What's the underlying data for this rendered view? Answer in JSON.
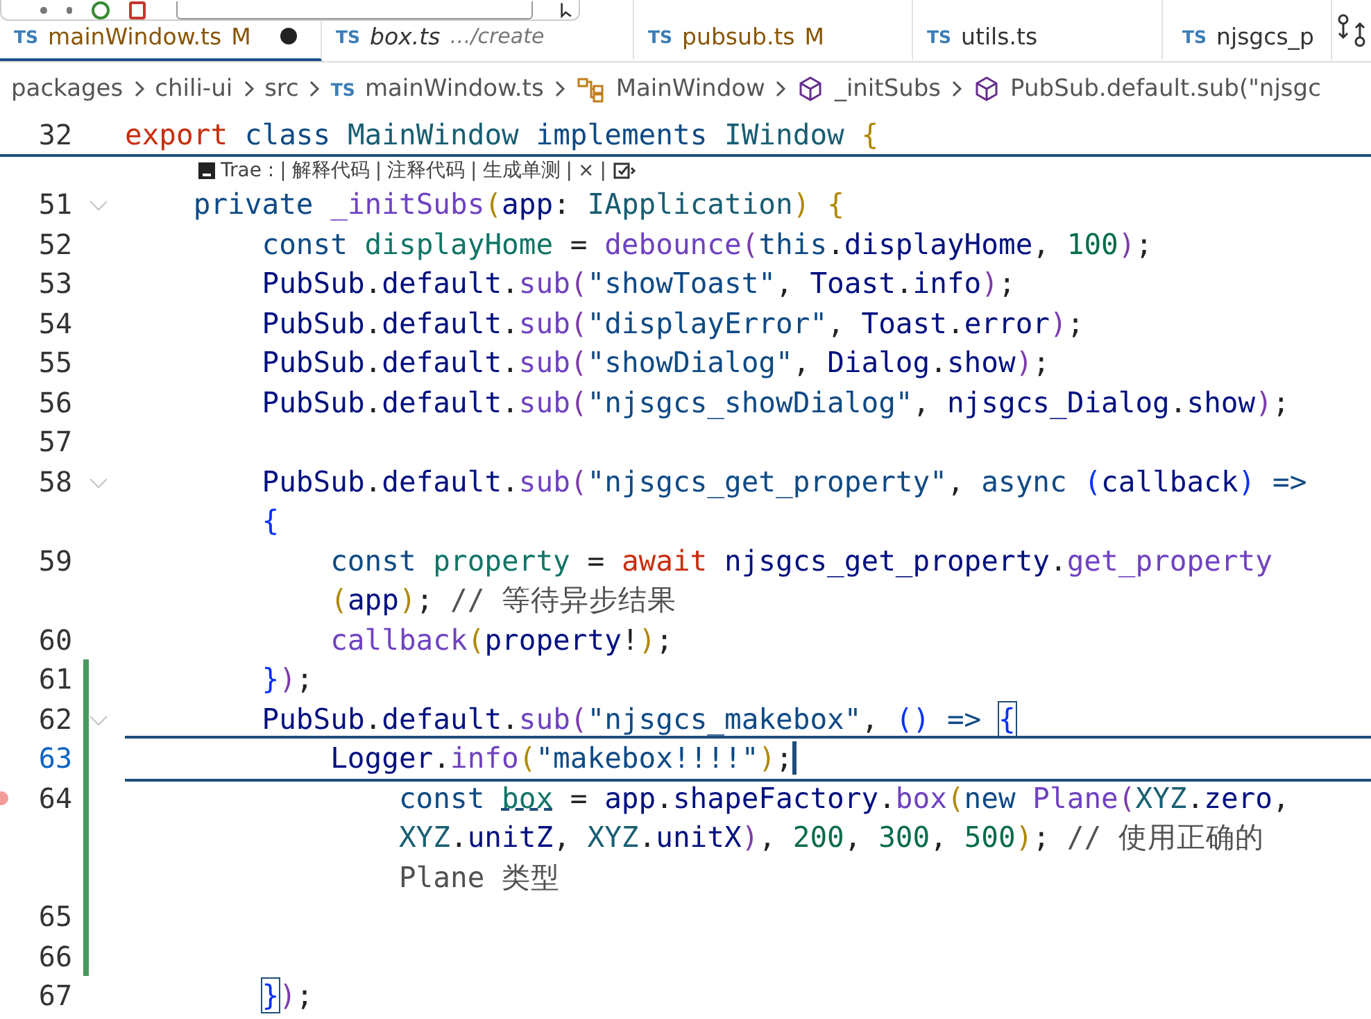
{
  "tabs": [
    {
      "label": "mainWindow.ts",
      "badge": "TS",
      "status": "M",
      "modified": true,
      "dirty": true,
      "preview": false,
      "selected": true
    },
    {
      "label": "box.ts",
      "badge": "TS",
      "description": "…/create",
      "modified": false,
      "dirty": false,
      "preview": true,
      "selected": false
    },
    {
      "label": "pubsub.ts",
      "badge": "TS",
      "status": "M",
      "modified": true,
      "dirty": false,
      "preview": false,
      "selected": false
    },
    {
      "label": "utils.ts",
      "badge": "TS",
      "modified": false,
      "dirty": false,
      "preview": false,
      "selected": false
    },
    {
      "label": "njsgcs_p",
      "badge": "TS",
      "modified": false,
      "dirty": false,
      "preview": false,
      "selected": false
    }
  ],
  "breadcrumb": [
    {
      "kind": "folder",
      "label": "packages"
    },
    {
      "kind": "folder",
      "label": "chili-ui"
    },
    {
      "kind": "folder",
      "label": "src"
    },
    {
      "kind": "file",
      "badge": "TS",
      "label": "mainWindow.ts"
    },
    {
      "kind": "class",
      "label": "MainWindow"
    },
    {
      "kind": "method",
      "label": "_initSubs"
    },
    {
      "kind": "method",
      "label": "PubSub.default.sub(\"njsgc"
    }
  ],
  "sticky_line": {
    "number": "32",
    "tokens": [
      {
        "t": "export ",
        "kind": "kw2"
      },
      {
        "t": "class ",
        "kind": "kw"
      },
      {
        "t": "MainWindow ",
        "kind": "type"
      },
      {
        "t": "implements ",
        "kind": "kw"
      },
      {
        "t": "IWindow ",
        "kind": "type"
      },
      {
        "t": "{",
        "kind": "b1"
      }
    ]
  },
  "codelens": {
    "label": "Trae :",
    "separator": "|",
    "actions": [
      "解释代码",
      "注释代码",
      "生成单测"
    ],
    "close": "×"
  },
  "lines": [
    {
      "number": "51",
      "fold": true,
      "modified": false,
      "current": false,
      "breakpoint": false,
      "rows": [
        {
          "tokens": [
            {
              "t": "private ",
              "kind": "kw"
            },
            {
              "t": "_initSubs",
              "kind": "fn"
            },
            {
              "t": "(",
              "kind": "b1"
            },
            {
              "t": "app",
              "kind": "var"
            },
            {
              "t": ": ",
              "kind": "punc"
            },
            {
              "t": "IApplication",
              "kind": "type"
            },
            {
              "t": ") ",
              "kind": "b1"
            },
            {
              "t": "{",
              "kind": "b1"
            }
          ]
        }
      ],
      "children": [
        {
          "number": "52",
          "fold": false,
          "modified": false,
          "current": false,
          "breakpoint": false,
          "rows": [
            {
              "tokens": [
                {
                  "t": "const ",
                  "kind": "kw"
                },
                {
                  "t": "displayHome",
                  "kind": "decl"
                },
                {
                  "t": " = ",
                  "kind": "punc"
                },
                {
                  "t": "debounce",
                  "kind": "fn"
                },
                {
                  "t": "(",
                  "kind": "b2"
                },
                {
                  "t": "this",
                  "kind": "kw"
                },
                {
                  "t": ".",
                  "kind": "punc"
                },
                {
                  "t": "displayHome",
                  "kind": "var"
                },
                {
                  "t": ", ",
                  "kind": "punc"
                },
                {
                  "t": "100",
                  "kind": "num"
                },
                {
                  "t": ")",
                  "kind": "b2"
                },
                {
                  "t": ";",
                  "kind": "punc"
                }
              ]
            }
          ]
        },
        {
          "number": "53",
          "fold": false,
          "modified": false,
          "current": false,
          "breakpoint": false,
          "rows": [
            {
              "tokens": [
                {
                  "t": "PubSub",
                  "kind": "var"
                },
                {
                  "t": ".",
                  "kind": "punc"
                },
                {
                  "t": "default",
                  "kind": "var"
                },
                {
                  "t": ".",
                  "kind": "punc"
                },
                {
                  "t": "sub",
                  "kind": "fn"
                },
                {
                  "t": "(",
                  "kind": "b2"
                },
                {
                  "t": "\"showToast\"",
                  "kind": "str"
                },
                {
                  "t": ", ",
                  "kind": "punc"
                },
                {
                  "t": "Toast",
                  "kind": "var"
                },
                {
                  "t": ".",
                  "kind": "punc"
                },
                {
                  "t": "info",
                  "kind": "var"
                },
                {
                  "t": ")",
                  "kind": "b2"
                },
                {
                  "t": ";",
                  "kind": "punc"
                }
              ]
            }
          ]
        },
        {
          "number": "54",
          "fold": false,
          "modified": false,
          "current": false,
          "breakpoint": false,
          "rows": [
            {
              "tokens": [
                {
                  "t": "PubSub",
                  "kind": "var"
                },
                {
                  "t": ".",
                  "kind": "punc"
                },
                {
                  "t": "default",
                  "kind": "var"
                },
                {
                  "t": ".",
                  "kind": "punc"
                },
                {
                  "t": "sub",
                  "kind": "fn"
                },
                {
                  "t": "(",
                  "kind": "b2"
                },
                {
                  "t": "\"displayError\"",
                  "kind": "str"
                },
                {
                  "t": ", ",
                  "kind": "punc"
                },
                {
                  "t": "Toast",
                  "kind": "var"
                },
                {
                  "t": ".",
                  "kind": "punc"
                },
                {
                  "t": "error",
                  "kind": "var"
                },
                {
                  "t": ")",
                  "kind": "b2"
                },
                {
                  "t": ";",
                  "kind": "punc"
                }
              ]
            }
          ]
        },
        {
          "number": "55",
          "fold": false,
          "modified": false,
          "current": false,
          "breakpoint": false,
          "rows": [
            {
              "tokens": [
                {
                  "t": "PubSub",
                  "kind": "var"
                },
                {
                  "t": ".",
                  "kind": "punc"
                },
                {
                  "t": "default",
                  "kind": "var"
                },
                {
                  "t": ".",
                  "kind": "punc"
                },
                {
                  "t": "sub",
                  "kind": "fn"
                },
                {
                  "t": "(",
                  "kind": "b2"
                },
                {
                  "t": "\"showDialog\"",
                  "kind": "str"
                },
                {
                  "t": ", ",
                  "kind": "punc"
                },
                {
                  "t": "Dialog",
                  "kind": "var"
                },
                {
                  "t": ".",
                  "kind": "punc"
                },
                {
                  "t": "show",
                  "kind": "var"
                },
                {
                  "t": ")",
                  "kind": "b2"
                },
                {
                  "t": ";",
                  "kind": "punc"
                }
              ]
            }
          ]
        },
        {
          "number": "56",
          "fold": false,
          "modified": false,
          "current": false,
          "breakpoint": false,
          "rows": [
            {
              "tokens": [
                {
                  "t": "PubSub",
                  "kind": "var"
                },
                {
                  "t": ".",
                  "kind": "punc"
                },
                {
                  "t": "default",
                  "kind": "var"
                },
                {
                  "t": ".",
                  "kind": "punc"
                },
                {
                  "t": "sub",
                  "kind": "fn"
                },
                {
                  "t": "(",
                  "kind": "b2"
                },
                {
                  "t": "\"njsgcs_showDialog\"",
                  "kind": "str"
                },
                {
                  "t": ", ",
                  "kind": "punc"
                },
                {
                  "t": "njsgcs_Dialog",
                  "kind": "var"
                },
                {
                  "t": ".",
                  "kind": "punc"
                },
                {
                  "t": "show",
                  "kind": "var"
                },
                {
                  "t": ")",
                  "kind": "b2"
                },
                {
                  "t": ";",
                  "kind": "punc"
                }
              ]
            }
          ]
        },
        {
          "number": "57",
          "fold": false,
          "modified": false,
          "current": false,
          "breakpoint": false
        },
        {
          "number": "58",
          "fold": true,
          "modified": false,
          "current": false,
          "breakpoint": false,
          "rows": [
            {
              "tokens": [
                {
                  "t": "PubSub",
                  "kind": "var"
                },
                {
                  "t": ".",
                  "kind": "punc"
                },
                {
                  "t": "default",
                  "kind": "var"
                },
                {
                  "t": ".",
                  "kind": "punc"
                },
                {
                  "t": "sub",
                  "kind": "fn"
                },
                {
                  "t": "(",
                  "kind": "b2"
                },
                {
                  "t": "\"njsgcs_get_property\"",
                  "kind": "str"
                },
                {
                  "t": ", ",
                  "kind": "punc"
                },
                {
                  "t": "async ",
                  "kind": "kw"
                },
                {
                  "t": "(",
                  "kind": "b3"
                },
                {
                  "t": "callback",
                  "kind": "var"
                },
                {
                  "t": ")",
                  "kind": "b3"
                },
                {
                  "t": " =>",
                  "kind": "kw"
                }
              ]
            },
            {
              "tokens": [
                {
                  "t": "{",
                  "kind": "b3"
                }
              ]
            }
          ],
          "children": [
            {
              "number": "59",
              "fold": false,
              "modified": false,
              "current": false,
              "breakpoint": false,
              "rows": [
                {
                  "tokens": [
                    {
                      "t": "const ",
                      "kind": "kw"
                    },
                    {
                      "t": "property",
                      "kind": "decl"
                    },
                    {
                      "t": " = ",
                      "kind": "punc"
                    },
                    {
                      "t": "await ",
                      "kind": "kw2"
                    },
                    {
                      "t": "njsgcs_get_property",
                      "kind": "var"
                    },
                    {
                      "t": ".",
                      "kind": "punc"
                    },
                    {
                      "t": "get_property",
                      "kind": "fn"
                    }
                  ]
                },
                {
                  "tokens": [
                    {
                      "t": "(",
                      "kind": "b1"
                    },
                    {
                      "t": "app",
                      "kind": "var"
                    },
                    {
                      "t": ")",
                      "kind": "b1"
                    },
                    {
                      "t": "; ",
                      "kind": "punc"
                    },
                    {
                      "t": "// 等待异步结果",
                      "kind": "com"
                    }
                  ]
                }
              ]
            },
            {
              "number": "60",
              "fold": false,
              "modified": false,
              "current": false,
              "breakpoint": false,
              "rows": [
                {
                  "tokens": [
                    {
                      "t": "callback",
                      "kind": "fn"
                    },
                    {
                      "t": "(",
                      "kind": "b1"
                    },
                    {
                      "t": "property",
                      "kind": "var"
                    },
                    {
                      "t": "!",
                      "kind": "punc"
                    },
                    {
                      "t": ")",
                      "kind": "b1"
                    },
                    {
                      "t": ";",
                      "kind": "punc"
                    }
                  ]
                }
              ]
            }
          ]
        },
        {
          "number": "61",
          "fold": false,
          "modified": true,
          "current": false,
          "breakpoint": false,
          "rows": [
            {
              "tokens": [
                {
                  "t": "}",
                  "kind": "b3"
                },
                {
                  "t": ")",
                  "kind": "b2"
                },
                {
                  "t": ";",
                  "kind": "punc"
                }
              ]
            }
          ]
        },
        {
          "number": "62",
          "fold": true,
          "modified": true,
          "current": false,
          "breakpoint": false,
          "rows": [
            {
              "tokens": [
                {
                  "t": "PubSub",
                  "kind": "var"
                },
                {
                  "t": ".",
                  "kind": "punc"
                },
                {
                  "t": "default",
                  "kind": "var"
                },
                {
                  "t": ".",
                  "kind": "punc"
                },
                {
                  "t": "sub",
                  "kind": "fn"
                },
                {
                  "t": "(",
                  "kind": "b2"
                },
                {
                  "t": "\"njsgcs_makebox\"",
                  "kind": "str"
                },
                {
                  "t": ", ",
                  "kind": "punc"
                },
                {
                  "t": "() ",
                  "kind": "b3"
                },
                {
                  "t": "=> ",
                  "kind": "kw"
                },
                {
                  "t": "{",
                  "kind": "b3m"
                }
              ]
            }
          ],
          "children": [
            {
              "number": "63",
              "fold": false,
              "modified": true,
              "current": true,
              "breakpoint": false,
              "rows": [
                {
                  "tokens": [
                    {
                      "t": "Logger",
                      "kind": "var"
                    },
                    {
                      "t": ".",
                      "kind": "punc"
                    },
                    {
                      "t": "info",
                      "kind": "fn"
                    },
                    {
                      "t": "(",
                      "kind": "b1"
                    },
                    {
                      "t": "\"makebox!!!!\"",
                      "kind": "str"
                    },
                    {
                      "t": ")",
                      "kind": "b1"
                    },
                    {
                      "t": ";",
                      "kind": "punc"
                    }
                  ]
                }
              ],
              "children": [
                {
                  "number": "64",
                  "fold": false,
                  "modified": true,
                  "current": false,
                  "breakpoint": true,
                  "rows": [
                    {
                      "tokens": [
                        {
                          "t": "const ",
                          "kind": "kw"
                        },
                        {
                          "t": "box",
                          "kind": "declhint"
                        },
                        {
                          "t": " = ",
                          "kind": "punc"
                        },
                        {
                          "t": "app",
                          "kind": "var"
                        },
                        {
                          "t": ".",
                          "kind": "punc"
                        },
                        {
                          "t": "shapeFactory",
                          "kind": "var"
                        },
                        {
                          "t": ".",
                          "kind": "punc"
                        },
                        {
                          "t": "box",
                          "kind": "fn"
                        },
                        {
                          "t": "(",
                          "kind": "b1"
                        },
                        {
                          "t": "new ",
                          "kind": "kw"
                        },
                        {
                          "t": "Plane",
                          "kind": "fn"
                        },
                        {
                          "t": "(",
                          "kind": "b2"
                        },
                        {
                          "t": "XYZ",
                          "kind": "type"
                        },
                        {
                          "t": ".",
                          "kind": "punc"
                        },
                        {
                          "t": "zero",
                          "kind": "var"
                        },
                        {
                          "t": ",",
                          "kind": "punc"
                        }
                      ]
                    },
                    {
                      "tokens": [
                        {
                          "t": "XYZ",
                          "kind": "type"
                        },
                        {
                          "t": ".",
                          "kind": "punc"
                        },
                        {
                          "t": "unitZ",
                          "kind": "var"
                        },
                        {
                          "t": ", ",
                          "kind": "punc"
                        },
                        {
                          "t": "XYZ",
                          "kind": "type"
                        },
                        {
                          "t": ".",
                          "kind": "punc"
                        },
                        {
                          "t": "unitX",
                          "kind": "var"
                        },
                        {
                          "t": ")",
                          "kind": "b2"
                        },
                        {
                          "t": ", ",
                          "kind": "punc"
                        },
                        {
                          "t": "200",
                          "kind": "num"
                        },
                        {
                          "t": ", ",
                          "kind": "punc"
                        },
                        {
                          "t": "300",
                          "kind": "num"
                        },
                        {
                          "t": ", ",
                          "kind": "punc"
                        },
                        {
                          "t": "500",
                          "kind": "num"
                        },
                        {
                          "t": ")",
                          "kind": "b1"
                        },
                        {
                          "t": "; ",
                          "kind": "punc"
                        },
                        {
                          "t": "// 使用正确的",
                          "kind": "com"
                        }
                      ]
                    },
                    {
                      "tokens": [
                        {
                          "t": "Plane 类型",
                          "kind": "com"
                        }
                      ]
                    }
                  ]
                }
              ]
            },
            {
              "number": "65",
              "fold": false,
              "modified": true,
              "current": false,
              "breakpoint": false
            },
            {
              "number": "66",
              "fold": false,
              "modified": true,
              "current": false,
              "breakpoint": false
            }
          ]
        },
        {
          "number": "67",
          "fold": false,
          "modified": false,
          "current": false,
          "breakpoint": false,
          "rows": [
            {
              "tokens": [
                {
                  "t": "}",
                  "kind": "b3m"
                },
                {
                  "t": ")",
                  "kind": "b2"
                },
                {
                  "t": ";",
                  "kind": "punc"
                }
              ]
            }
          ]
        }
      ]
    }
  ]
}
